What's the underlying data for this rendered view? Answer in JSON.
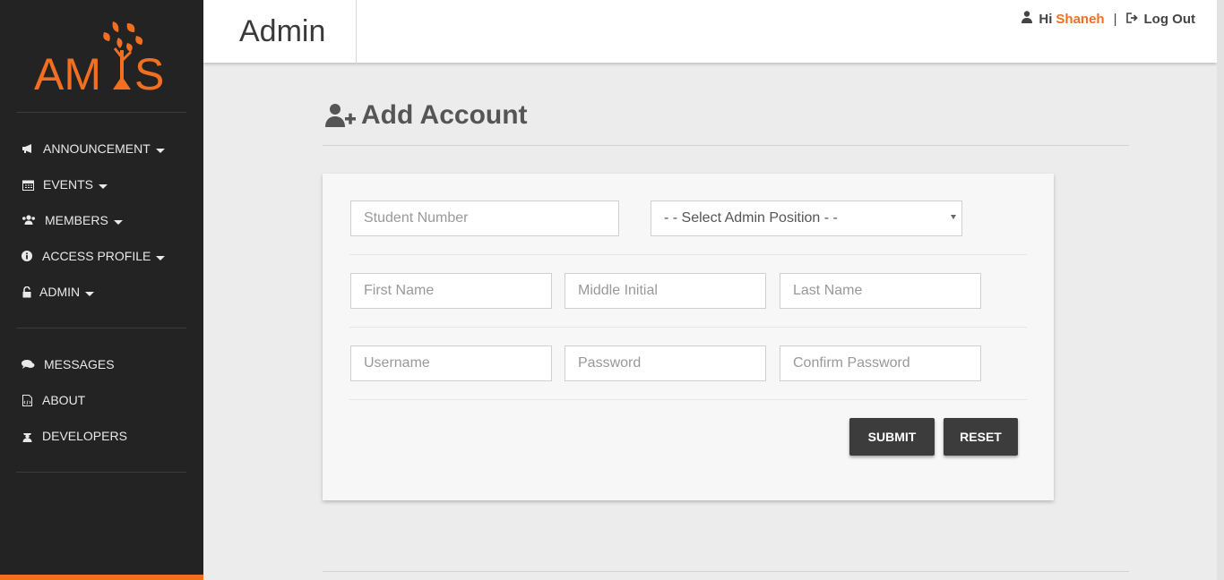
{
  "sidebar": {
    "logo_text": "AMIS",
    "nav_top": [
      {
        "label": "ANNOUNCEMENT",
        "icon": "megaphone-icon"
      },
      {
        "label": "EVENTS",
        "icon": "calendar-icon"
      },
      {
        "label": "MEMBERS",
        "icon": "users-icon"
      },
      {
        "label": "ACCESS PROFILE",
        "icon": "info-icon"
      },
      {
        "label": "ADMIN",
        "icon": "unlock-icon"
      }
    ],
    "nav_bottom": [
      {
        "label": "MESSAGES",
        "icon": "comments-icon"
      },
      {
        "label": "ABOUT",
        "icon": "file-icon"
      },
      {
        "label": "DEVELOPERS",
        "icon": "developer-icon"
      }
    ]
  },
  "header": {
    "title": "Admin",
    "greeting": "Hi",
    "user_name": "Shaneh",
    "separator": "|",
    "logout_label": "Log Out"
  },
  "main": {
    "heading": "Add Account",
    "form": {
      "student_number_placeholder": "Student Number",
      "admin_position_selected": "- - Select Admin Position - -",
      "first_name_placeholder": "First Name",
      "middle_initial_placeholder": "Middle Initial",
      "last_name_placeholder": "Last Name",
      "username_placeholder": "Username",
      "password_placeholder": "Password",
      "confirm_password_placeholder": "Confirm Password",
      "submit_label": "SUBMIT",
      "reset_label": "RESET"
    }
  },
  "colors": {
    "accent": "#f26f21",
    "sidebar_bg": "#232323",
    "button_bg": "#3c3c3c"
  }
}
